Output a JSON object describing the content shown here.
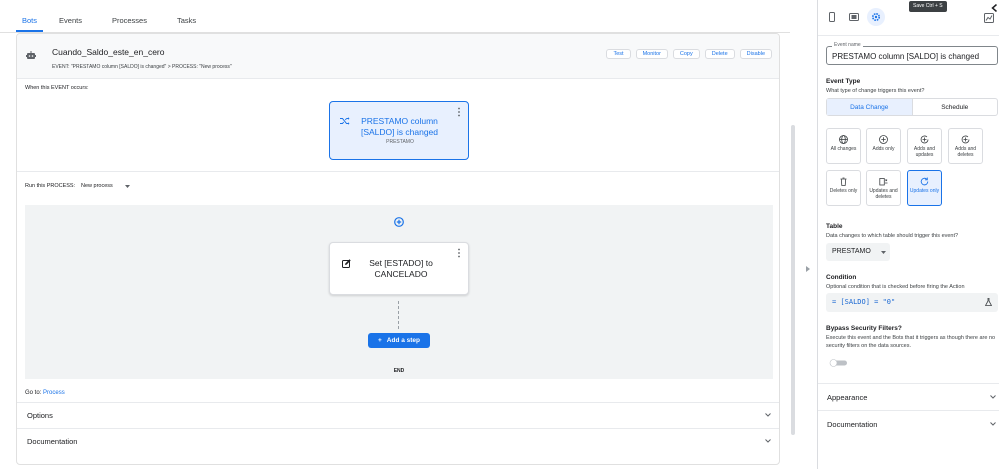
{
  "tabs": [
    "Bots",
    "Events",
    "Processes",
    "Tasks"
  ],
  "bot": {
    "title": "Cuando_Saldo_este_en_cero",
    "subtitle": "EVENT: \"PRESTAMO column [SALDO] is changed\" > PROCESS: \"New process\"",
    "actions": [
      "Test",
      "Monitor",
      "Copy",
      "Delete",
      "Disable"
    ]
  },
  "event_section": {
    "label": "When this EVENT occurs:",
    "card_title": "PRESTAMO column [SALDO] is changed",
    "card_table": "PRESTAMO"
  },
  "process_section": {
    "label": "Run this PROCESS:",
    "value": "New process",
    "step_title": "Set [ESTADO] to CANCELADO",
    "add_step_label": "Add a step",
    "end_label": "END"
  },
  "goto": {
    "prefix": "Go to:",
    "link": "Process"
  },
  "left_sections": [
    "Options",
    "Documentation"
  ],
  "icons": {
    "bot": "bot-icon",
    "event": "shuffle-icon",
    "step": "edit-icon",
    "plus": "add-circle-icon",
    "kebab": "more-vert-icon",
    "chevron": "chevron-down-icon",
    "phone": "phone-icon",
    "tablet": "tablet-icon",
    "settings": "gear-icon",
    "analytics": "analytics-icon",
    "back": "chevron-left-icon",
    "expression": "flask-icon"
  },
  "right_panel": {
    "tooltip": "Save Ctrl + S",
    "event_name": {
      "label": "Event name",
      "value": "PRESTAMO column [SALDO] is changed"
    },
    "event_type": {
      "title": "Event Type",
      "desc": "What type of change triggers this event?",
      "options": [
        "Data Change",
        "Schedule"
      ],
      "selected": "Data Change"
    },
    "change_types": [
      {
        "label": "All changes",
        "icon": "globe-icon"
      },
      {
        "label": "Adds only",
        "icon": "plus-circle-icon"
      },
      {
        "label": "Adds and updates",
        "icon": "plus-refresh-icon"
      },
      {
        "label": "Adds and deletes",
        "icon": "plus-delete-icon"
      },
      {
        "label": "Deletes only",
        "icon": "trash-icon"
      },
      {
        "label": "Updates and deletes",
        "icon": "update-delete-icon"
      },
      {
        "label": "Updates only",
        "icon": "refresh-icon"
      }
    ],
    "selected_change": "Updates only",
    "table": {
      "title": "Table",
      "desc": "Data changes to which table should trigger this event?",
      "value": "PRESTAMO"
    },
    "condition": {
      "title": "Condition",
      "desc": "Optional condition that is checked before firing the Action",
      "value": "= [SALDO] = \"0\""
    },
    "bypass": {
      "title": "Bypass Security Filters?",
      "desc": "Execute this event and the Bots that it triggers as though there are no security filters on the data sources.",
      "enabled": false
    },
    "sections": [
      "Appearance",
      "Documentation"
    ]
  },
  "colors": {
    "accent": "#1a73e8",
    "accent_bg": "#e8f0fe",
    "border": "#dadce0"
  }
}
